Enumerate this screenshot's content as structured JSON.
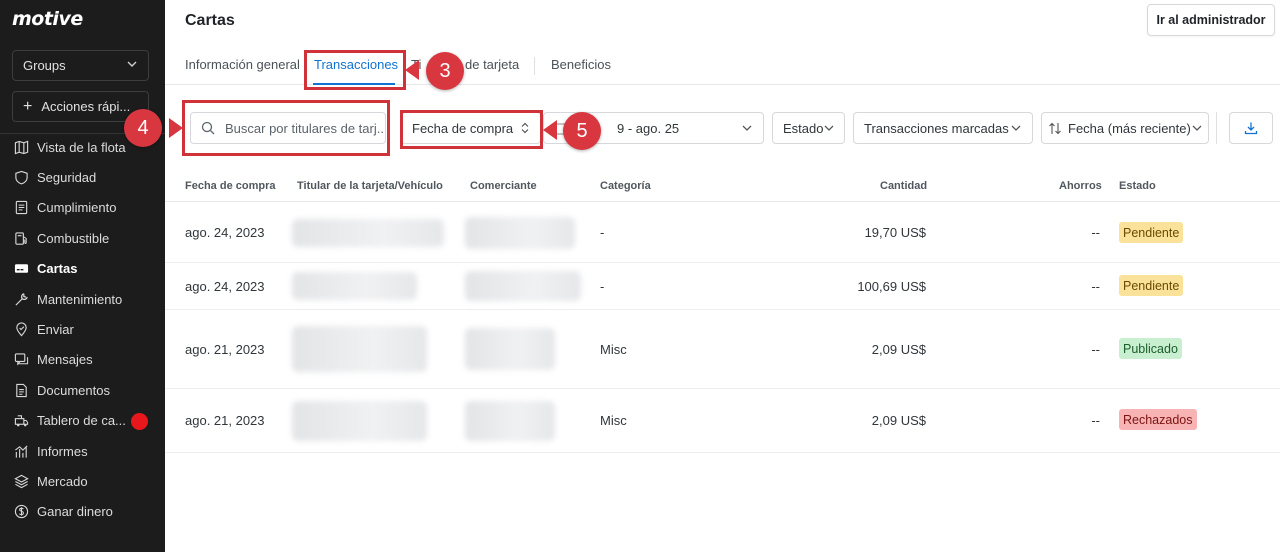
{
  "brand": {
    "logo": "motive"
  },
  "sidebar": {
    "groups_label": "Groups",
    "quick_actions_label": "Acciones rápi...",
    "items": [
      {
        "label": "Vista de la flota",
        "icon": "map-icon",
        "active": false
      },
      {
        "label": "Seguridad",
        "icon": "shield-icon",
        "active": false
      },
      {
        "label": "Cumplimiento",
        "icon": "clipboard-icon",
        "active": false
      },
      {
        "label": "Combustible",
        "icon": "fuel-icon",
        "active": false
      },
      {
        "label": "Cartas",
        "icon": "card-icon",
        "active": true
      },
      {
        "label": "Mantenimiento",
        "icon": "wrench-icon",
        "active": false
      },
      {
        "label": "Enviar",
        "icon": "location-icon",
        "active": false
      },
      {
        "label": "Mensajes",
        "icon": "chat-icon",
        "active": false
      },
      {
        "label": "Documentos",
        "icon": "document-icon",
        "active": false
      },
      {
        "label": "Tablero de ca...",
        "icon": "cargo-icon",
        "active": false
      },
      {
        "label": "Informes",
        "icon": "chart-icon",
        "active": false
      },
      {
        "label": "Mercado",
        "icon": "layers-icon",
        "active": false
      },
      {
        "label": "Ganar dinero",
        "icon": "dollar-icon",
        "active": false
      }
    ]
  },
  "header": {
    "title": "Cartas",
    "admin_button": "Ir al administrador"
  },
  "tabs": [
    {
      "label": "Información general",
      "active": false
    },
    {
      "label": "Transacciones",
      "active": true
    },
    {
      "label": "Ti",
      "active": false
    },
    {
      "label": "de tarjeta",
      "active": false
    },
    {
      "label": "Beneficios",
      "active": false
    }
  ],
  "filters": {
    "search_placeholder": "Buscar por titulares de tarj...",
    "date_type": "Fecha de compra",
    "date_range": "9 - ago. 25",
    "status": "Estado",
    "flagged": "Transacciones marcadas",
    "sort": "Fecha (más reciente)"
  },
  "table": {
    "headers": [
      "Fecha de compra",
      "Titular de la tarjeta/Vehículo",
      "Comerciante",
      "Categoría",
      "Cantidad",
      "Ahorros",
      "Estado"
    ],
    "rows": [
      {
        "date": "ago. 24, 2023",
        "category": "-",
        "amount": "19,70 US$",
        "savings": "--",
        "status": "Pendiente",
        "status_kind": "pending"
      },
      {
        "date": "ago. 24, 2023",
        "category": "-",
        "amount": "100,69 US$",
        "savings": "--",
        "status": "Pendiente",
        "status_kind": "pending"
      },
      {
        "date": "ago. 21, 2023",
        "category": "Misc",
        "amount": "2,09 US$",
        "savings": "--",
        "status": "Publicado",
        "status_kind": "published"
      },
      {
        "date": "ago. 21, 2023",
        "category": "Misc",
        "amount": "2,09 US$",
        "savings": "--",
        "status": "Rechazados",
        "status_kind": "rejected"
      }
    ]
  },
  "annotations": [
    {
      "number": "3"
    },
    {
      "number": "4"
    },
    {
      "number": "5"
    }
  ],
  "colors": {
    "accent": "#1172d4",
    "sidebar_bg": "#1c1c1c",
    "annotation_red": "#d93740",
    "pending": "#fbe29a",
    "published": "#c9efd1",
    "rejected": "#f8b4b4"
  }
}
